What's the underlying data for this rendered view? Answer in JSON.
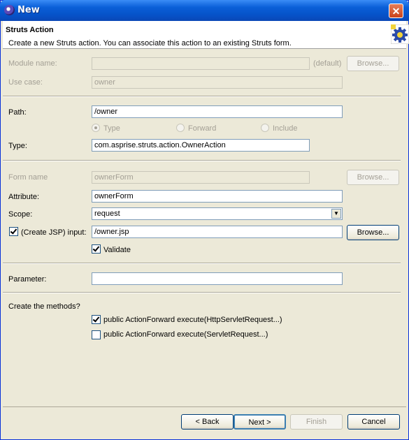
{
  "window": {
    "title": "New",
    "close_label": "✕"
  },
  "header": {
    "title": "Struts Action",
    "description": "Create a new Struts action. You can associate this action to an existing Struts form."
  },
  "module": {
    "label": "Module name:",
    "value": "",
    "default_label": "(default)",
    "browse_label": "Browse..."
  },
  "usecase": {
    "label": "Use case:",
    "value": "owner"
  },
  "path": {
    "label": "Path:",
    "value": "/owner"
  },
  "radios": {
    "type": "Type",
    "forward": "Forward",
    "include": "Include"
  },
  "type": {
    "label": "Type:",
    "value": "com.asprise.struts.action.OwnerAction"
  },
  "formname": {
    "label": "Form name",
    "value": "ownerForm",
    "browse_label": "Browse..."
  },
  "attribute": {
    "label": "Attribute:",
    "value": "ownerForm"
  },
  "scope": {
    "label": "Scope:",
    "value": "request"
  },
  "input": {
    "label": "(Create JSP) input:",
    "value": "/owner.jsp",
    "browse_label": "Browse...",
    "checked": true
  },
  "validate": {
    "label": "Validate",
    "checked": true
  },
  "parameter": {
    "label": "Parameter:",
    "value": ""
  },
  "methods": {
    "label": "Create the methods?",
    "execute_http": "public ActionForward execute(HttpServletRequest...)",
    "execute_servlet": "public ActionForward execute(ServletRequest...)"
  },
  "buttons": {
    "back": "< Back",
    "next": "Next >",
    "finish": "Finish",
    "cancel": "Cancel"
  }
}
